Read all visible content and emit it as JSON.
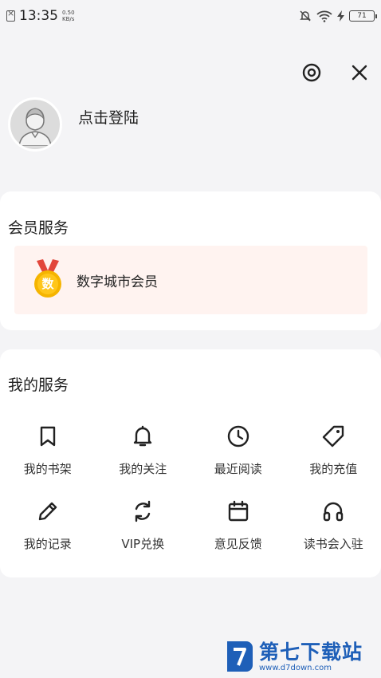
{
  "status_bar": {
    "time": "13:35",
    "speed_value": "0.50",
    "speed_unit": "KB/s",
    "battery": "71"
  },
  "profile": {
    "login_text": "点击登陆"
  },
  "member": {
    "title": "会员服务",
    "item_label": "数字城市会员",
    "badge_char": "数"
  },
  "services": {
    "title": "我的服务",
    "items": [
      {
        "label": "我的书架",
        "icon": "bookmark-icon"
      },
      {
        "label": "我的关注",
        "icon": "bell-icon"
      },
      {
        "label": "最近阅读",
        "icon": "clock-icon"
      },
      {
        "label": "我的充值",
        "icon": "tag-icon"
      },
      {
        "label": "我的记录",
        "icon": "pencil-icon"
      },
      {
        "label": "VIP兑换",
        "icon": "refresh-icon"
      },
      {
        "label": "意见反馈",
        "icon": "calendar-icon"
      },
      {
        "label": "读书会入驻",
        "icon": "headphones-icon"
      }
    ]
  },
  "watermark": {
    "name": "第七下载站",
    "url": "www.d7down.com"
  },
  "colors": {
    "background": "#f4f4f6",
    "card": "#ffffff",
    "member_bg": "#fff3f0",
    "badge_gold": "#f5b400",
    "watermark_blue": "#1e5fb8"
  }
}
